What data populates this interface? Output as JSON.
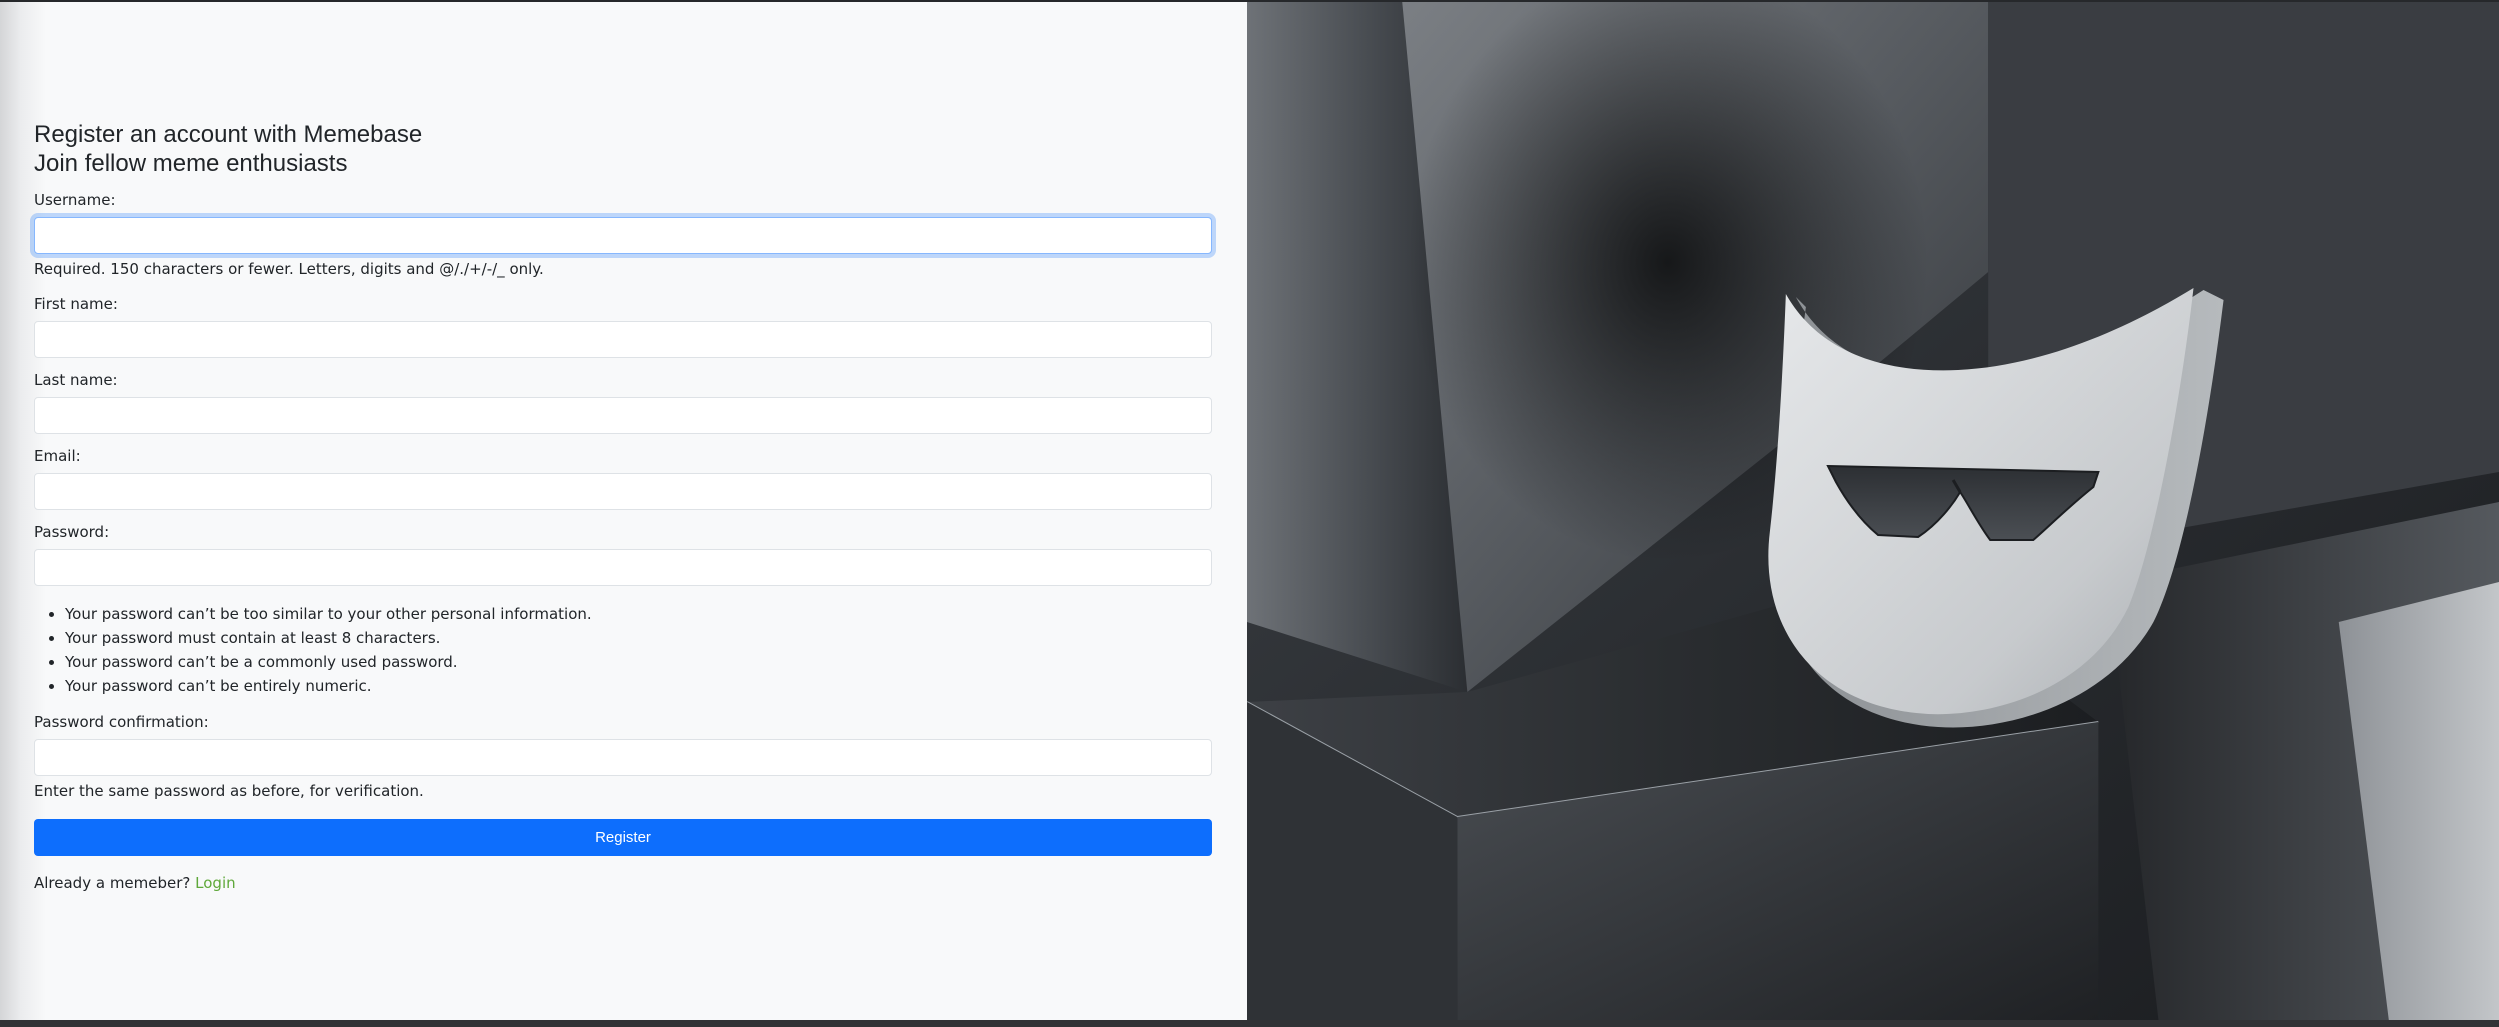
{
  "header": {
    "title": "Register an account with Memebase",
    "subtitle": "Join fellow meme enthusiasts"
  },
  "form": {
    "username": {
      "label": "Username:",
      "value": "",
      "help": "Required. 150 characters or fewer. Letters, digits and @/./+/-/_ only."
    },
    "first_name": {
      "label": "First name:",
      "value": ""
    },
    "last_name": {
      "label": "Last name:",
      "value": ""
    },
    "email": {
      "label": "Email:",
      "value": ""
    },
    "password": {
      "label": "Password:",
      "value": "",
      "rules": [
        "Your password can’t be too similar to your other personal information.",
        "Your password must contain at least 8 characters.",
        "Your password can’t be a commonly used password.",
        "Your password can’t be entirely numeric."
      ]
    },
    "password_confirmation": {
      "label": "Password confirmation:",
      "value": "",
      "help": "Enter the same password as before, for verification."
    },
    "submit_label": "Register"
  },
  "footer": {
    "prompt": "Already a memeber?",
    "login_link": "Login"
  },
  "hero": {
    "icon": "memebase-mascot-sunglasses-shield"
  },
  "colors": {
    "primary": "#0d6efd",
    "link": "#5fa83a",
    "panel_bg": "#f8f9fa",
    "text": "#212529"
  }
}
